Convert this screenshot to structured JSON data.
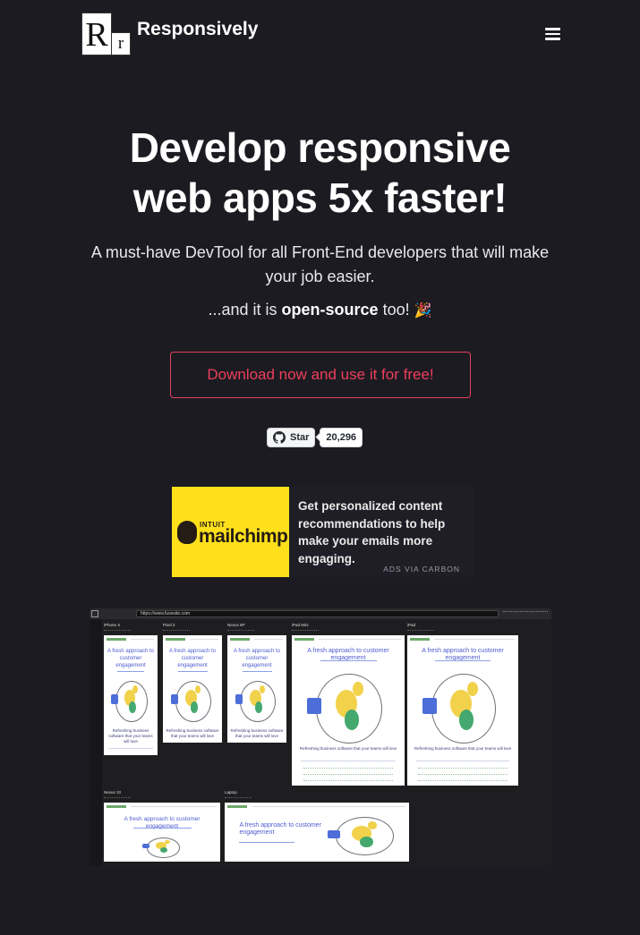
{
  "header": {
    "logo_big": "R",
    "logo_small": "r",
    "brand": "Responsively",
    "menu_icon": "hamburger-menu-icon"
  },
  "hero": {
    "title_line1": "Develop responsive",
    "title_line2": "web apps 5x faster!",
    "subtitle": "A must-have DevTool for all Front-End developers that will make your job easier.",
    "oss_prefix": "...and it is ",
    "oss_bold": "open-source",
    "oss_suffix": " too! ",
    "oss_emoji": "🎉",
    "cta_label": "Download now and use it for free!",
    "cta_color": "#ec3f5b"
  },
  "github": {
    "star_label": "Star",
    "star_count": "20,296",
    "icon": "github-icon"
  },
  "ad": {
    "brand_small": "INTUIT",
    "brand": "mailchimp",
    "text": "Get personalized content recommendations to help make your emails more engaging.",
    "via": "ADS VIA CARBON",
    "bg_color": "#ffe01b"
  },
  "screenshot": {
    "url": "https://www.fusesite.com",
    "devices": [
      {
        "label": "iPhone X",
        "headline": "A fresh approach to customer engagement",
        "footer": "Refreshing business software that your teams will love"
      },
      {
        "label": "Pixel 2",
        "headline": "A fresh approach to customer engagement",
        "footer": "Refreshing business software that your teams will love"
      },
      {
        "label": "Nexus 6P",
        "headline": "A fresh approach to customer engagement",
        "footer": "Refreshing business software that your teams will love"
      },
      {
        "label": "iPad Mini",
        "headline": "A fresh approach to customer engagement",
        "footer": "Refreshing business software that your teams will love"
      },
      {
        "label": "iPad",
        "headline": "A fresh approach to customer engagement",
        "footer": "Refreshing business software that your teams will love"
      },
      {
        "label": "Nexus 10",
        "headline": "A fresh approach to customer engagement",
        "footer": ""
      },
      {
        "label": "Laptop",
        "headline": "A fresh approach to customer engagement",
        "footer": ""
      }
    ]
  }
}
